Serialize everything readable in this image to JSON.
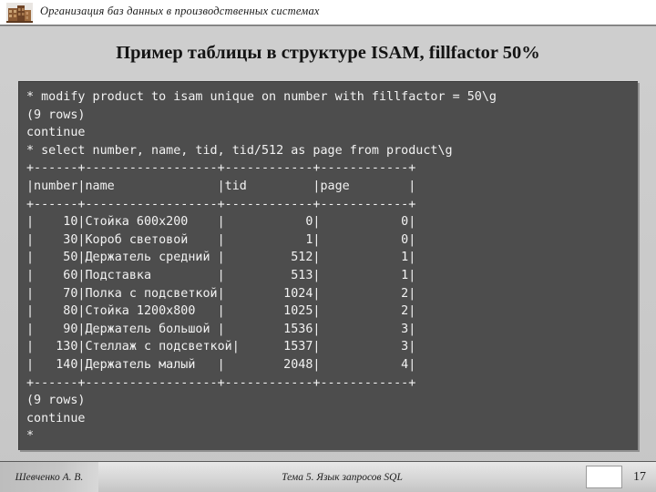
{
  "header": {
    "icon": "factory-building-icon",
    "title": "Организация баз данных в производственных системах"
  },
  "slide": {
    "title": "Пример таблицы в структуре ISAM, fillfactor 50%"
  },
  "terminal": {
    "lines": [
      "* modify product to isam unique on number with fillfactor = 50\\g",
      "(9 rows)",
      "continue",
      "* select number, name, tid, tid/512 as page from product\\g",
      "+------+------------------+------------+------------+",
      "|number|name              |tid         |page        |",
      "+------+------------------+------------+------------+",
      "|    10|Стойка 600x200    |           0|           0|",
      "|    30|Короб световой    |           1|           0|",
      "|    50|Держатель средний |         512|           1|",
      "|    60|Подставка         |         513|           1|",
      "|    70|Полка с подсветкой|        1024|           2|",
      "|    80|Стойка 1200x800   |        1025|           2|",
      "|    90|Держатель большой |        1536|           3|",
      "|   130|Стеллаж с подсветкой|      1537|           3|",
      "|   140|Держатель малый   |        2048|           4|",
      "+------+------------------+------------+------------+",
      "(9 rows)",
      "continue",
      "*"
    ],
    "command_1": "* modify product to isam unique on number with fillfactor = 50\\g",
    "command_2": "* select number, name, tid, tid/512 as page from product\\g",
    "status_rows": "(9 rows)",
    "status_continue": "continue",
    "prompt": "*",
    "columns": [
      "number",
      "name",
      "tid",
      "page"
    ],
    "rows": [
      {
        "number": "10",
        "name": "Стойка 600x200",
        "tid": "0",
        "page": "0"
      },
      {
        "number": "30",
        "name": "Короб световой",
        "tid": "1",
        "page": "0"
      },
      {
        "number": "50",
        "name": "Держатель средний",
        "tid": "512",
        "page": "1"
      },
      {
        "number": "60",
        "name": "Подставка",
        "tid": "513",
        "page": "1"
      },
      {
        "number": "70",
        "name": "Полка с подсветкой",
        "tid": "1024",
        "page": "2"
      },
      {
        "number": "80",
        "name": "Стойка 1200x800",
        "tid": "1025",
        "page": "2"
      },
      {
        "number": "90",
        "name": "Держатель большой",
        "tid": "1536",
        "page": "3"
      },
      {
        "number": "130",
        "name": "Стеллаж с подсветкой",
        "tid": "1537",
        "page": "3"
      },
      {
        "number": "140",
        "name": "Держатель малый",
        "tid": "2048",
        "page": "4"
      }
    ]
  },
  "footer": {
    "author": "Шевченко А. В.",
    "topic": "Тема 5. Язык запросов SQL",
    "page_number": "17"
  },
  "colors": {
    "terminal_bg": "#4d4d4d",
    "terminal_text": "#f2f2f2",
    "slide_bg": "#c9c9c9",
    "header_bg": "#ffffff",
    "title_text": "#141414"
  }
}
